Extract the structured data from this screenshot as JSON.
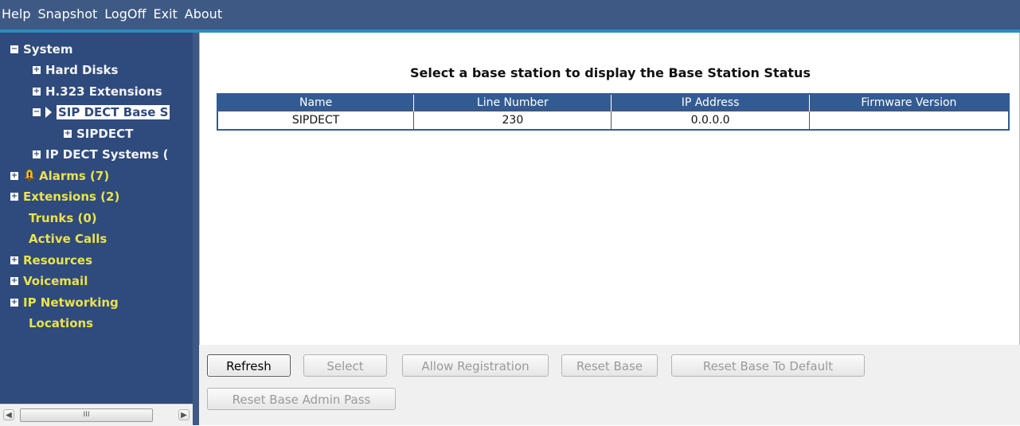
{
  "menu": [
    "Help",
    "Snapshot",
    "LogOff",
    "Exit",
    "About"
  ],
  "tree": {
    "system": "System",
    "hard_disks": "Hard Disks",
    "h323": "H.323 Extensions",
    "sip_dect": "SIP DECT Base S",
    "sipdect": "SIPDECT",
    "ip_dect": "IP DECT Systems (",
    "alarms": "Alarms (7)",
    "extensions": "Extensions (2)",
    "trunks": "Trunks (0)",
    "active_calls": "Active Calls",
    "resources": "Resources",
    "voicemail": "Voicemail",
    "ip_networking": "IP Networking",
    "locations": "Locations"
  },
  "scroll_thumb": "III",
  "main": {
    "title": "Select a base station to display the Base Station Status",
    "columns": [
      "Name",
      "Line Number",
      "IP Address",
      "Firmware Version"
    ],
    "rows": [
      [
        "SIPDECT",
        "230",
        "0.0.0.0",
        ""
      ]
    ]
  },
  "buttons": {
    "refresh": "Refresh",
    "select": "Select",
    "allow_registration": "Allow Registration",
    "reset_base": "Reset Base",
    "reset_default": "Reset Base To Default",
    "reset_admin": "Reset Base Admin Pass"
  },
  "colors": {
    "menubar": "#3e5a84",
    "sidebar": "#2f4a7c",
    "tree_text": "#e9e34a",
    "table_header": "#335b93"
  }
}
